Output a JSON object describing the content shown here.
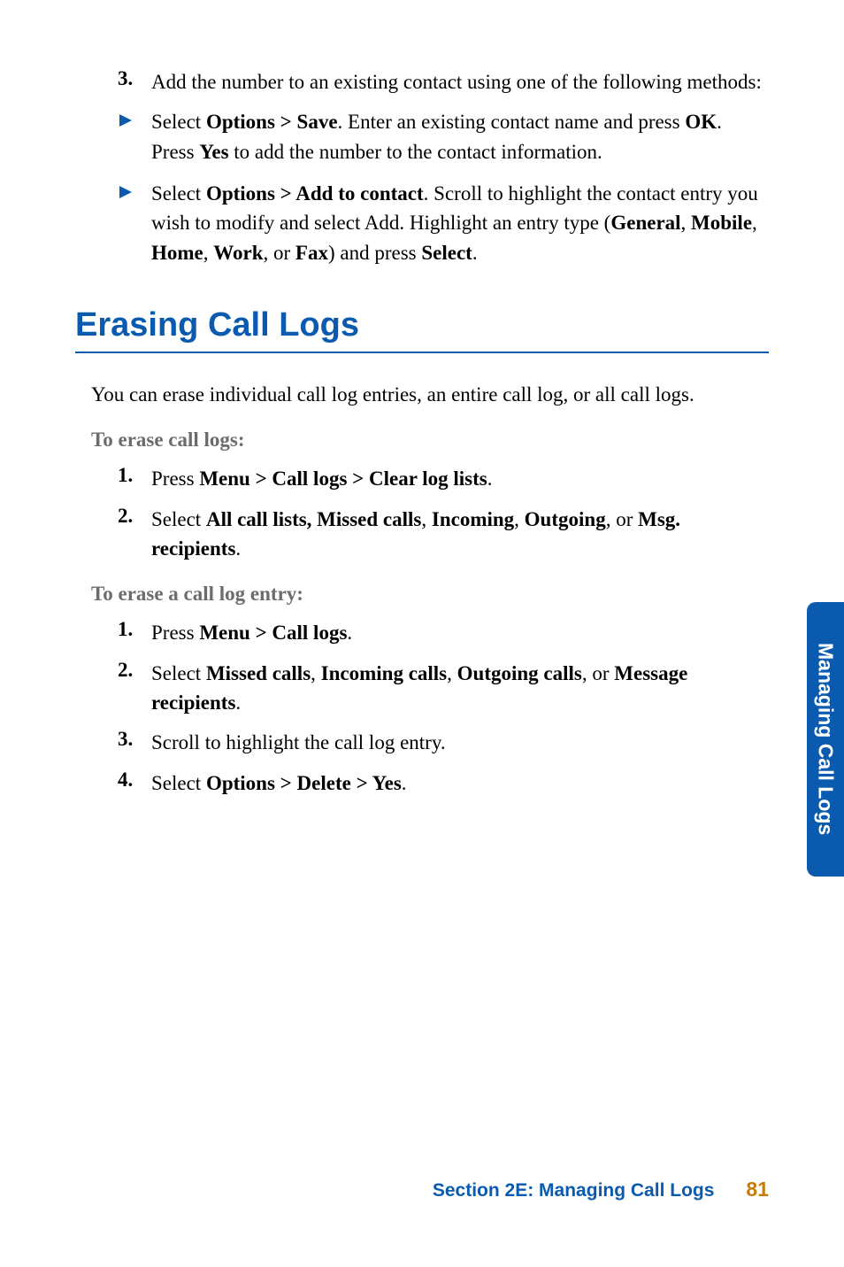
{
  "top_list": {
    "item3": {
      "num": "3.",
      "text": "Add the number to an existing contact using one of the following methods:"
    },
    "bullet1": {
      "pre": "Select ",
      "b1": "Options > Save",
      "mid1": ". Enter an existing contact name and press ",
      "b2": "OK",
      "mid2": ". Press ",
      "b3": "Yes",
      "post": " to add the number to the contact information."
    },
    "bullet2": {
      "pre": "Select ",
      "b1": "Options > Add to contact",
      "mid1": ". Scroll to highlight the contact entry you wish to modify and select Add. Highlight an entry type (",
      "b2": "General",
      "c1": ", ",
      "b3": "Mobile",
      "c2": ", ",
      "b4": "Home",
      "c3": ", ",
      "b5": "Work",
      "c4": ", or ",
      "b6": "Fax",
      "mid2": ") and press ",
      "b7": "Select",
      "post": "."
    }
  },
  "heading": "Erasing Call Logs",
  "intro": "You can erase individual call log entries, an entire call log, or all call logs.",
  "sub1": {
    "title": "To erase call logs:",
    "item1": {
      "num": "1.",
      "pre": "Press ",
      "b1": "Menu > Call logs > Clear log lists",
      "post": "."
    },
    "item2": {
      "num": "2.",
      "pre": "Select ",
      "b1": "All call lists, Missed calls",
      "c1": ", ",
      "b2": "Incoming",
      "c2": ", ",
      "b3": "Outgoing",
      "c3": ", or ",
      "b4": "Msg. recipients",
      "post": "."
    }
  },
  "sub2": {
    "title": "To erase a call log entry:",
    "item1": {
      "num": "1.",
      "pre": "Press ",
      "b1": "Menu > Call logs",
      "post": "."
    },
    "item2": {
      "num": "2.",
      "pre": "Select ",
      "b1": "Missed calls",
      "c1": ", ",
      "b2": "Incoming calls",
      "c2": ", ",
      "b3": "Outgoing calls",
      "c3": ", or ",
      "b4": "Message recipients",
      "post": "."
    },
    "item3": {
      "num": "3.",
      "text": "Scroll to highlight the call log entry."
    },
    "item4": {
      "num": "4.",
      "pre": "Select ",
      "b1": "Options > Delete > Yes",
      "post": "."
    }
  },
  "side_tab": "Managing Call Logs",
  "footer": {
    "title": "Section 2E: Managing Call Logs",
    "page": "81"
  }
}
